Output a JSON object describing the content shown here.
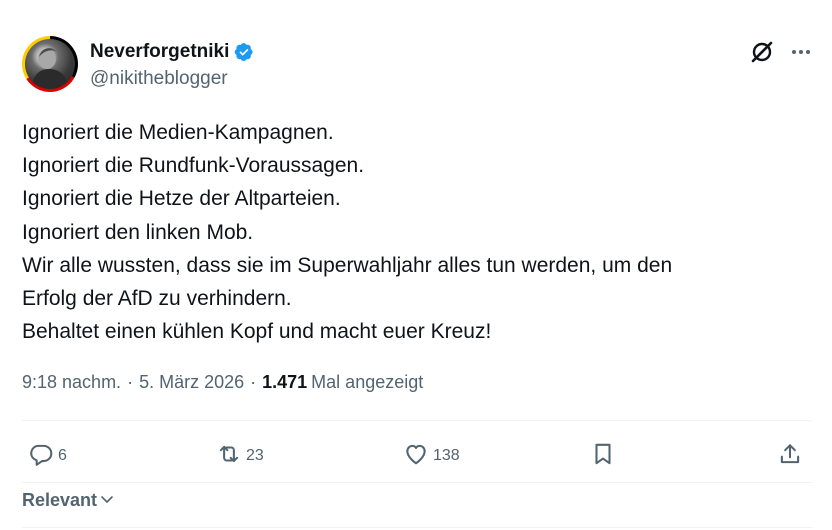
{
  "author": {
    "display_name": "Neverforgetniki",
    "handle": "@nikitheblogger",
    "verified": true,
    "avatar_frame_colors": [
      "#000000",
      "#dd0000",
      "#ffcc00"
    ]
  },
  "tweet": {
    "lines": [
      "Ignoriert die Medien-Kampagnen.",
      "Ignoriert die Rundfunk-Voraussagen.",
      "Ignoriert die Hetze der Altparteien.",
      "Ignoriert den linken Mob.",
      "Wir alle wussten, dass sie im Superwahljahr alles tun werden, um den",
      "Erfolg der AfD zu verhindern.",
      "Behaltet einen kühlen Kopf und macht euer Kreuz!"
    ]
  },
  "meta": {
    "time": "9:18 nachm.",
    "separator": "·",
    "date": "5. März 2026",
    "views_count": "1.471",
    "views_label": "Mal angezeigt"
  },
  "actions": {
    "replies": "6",
    "retweets": "23",
    "likes": "138"
  },
  "icons": {
    "header": [
      "grok-icon",
      "more-icon"
    ],
    "actions": [
      "reply-icon",
      "retweet-icon",
      "like-icon",
      "bookmark-icon",
      "share-icon"
    ]
  },
  "replies_sort": {
    "label": "Relevant"
  },
  "colors": {
    "text_primary": "#0f1419",
    "text_secondary": "#536471",
    "verified_blue": "#1d9bf0",
    "divider": "#eff3f4"
  }
}
